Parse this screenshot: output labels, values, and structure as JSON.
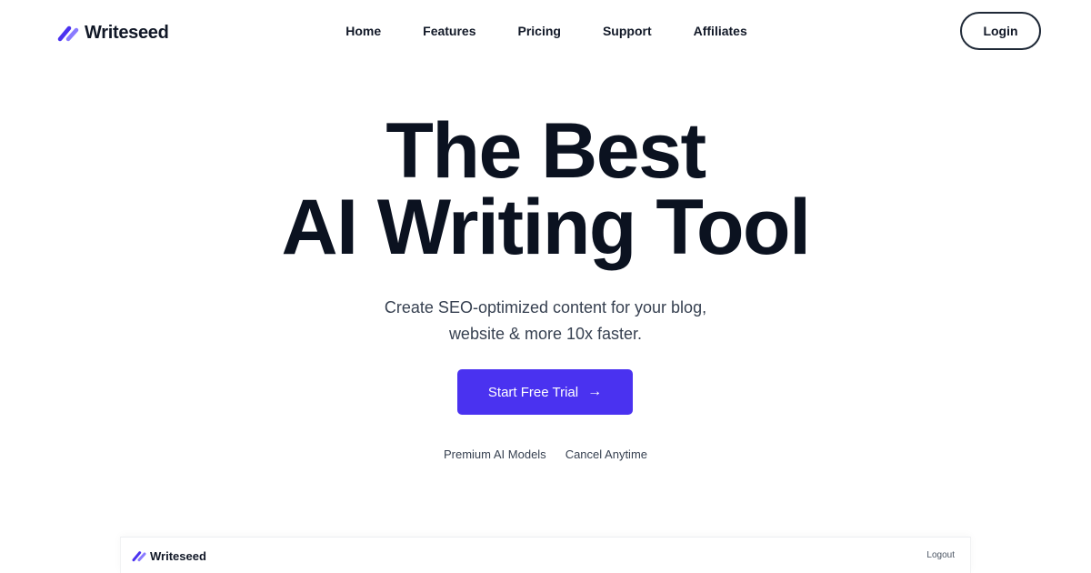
{
  "brand": {
    "name": "Writeseed",
    "icon": "writeseed-logo-icon",
    "colors": {
      "primary": "#4a32f0",
      "secondary": "#8a7bff"
    }
  },
  "nav": {
    "links": [
      "Home",
      "Features",
      "Pricing",
      "Support",
      "Affiliates"
    ],
    "login_label": "Login"
  },
  "hero": {
    "title_line1": "The Best",
    "title_line2": "AI Writing Tool",
    "subtitle_line1": "Create SEO-optimized content for your blog,",
    "subtitle_line2": "website & more 10x faster.",
    "cta_label": "Start Free Trial",
    "cta_icon": "arrow-right-icon",
    "cta_color": "#4a32f0",
    "features": [
      "Premium AI Models",
      "Cancel Anytime"
    ]
  },
  "preview": {
    "brand_name": "Writeseed",
    "logout_label": "Logout"
  }
}
